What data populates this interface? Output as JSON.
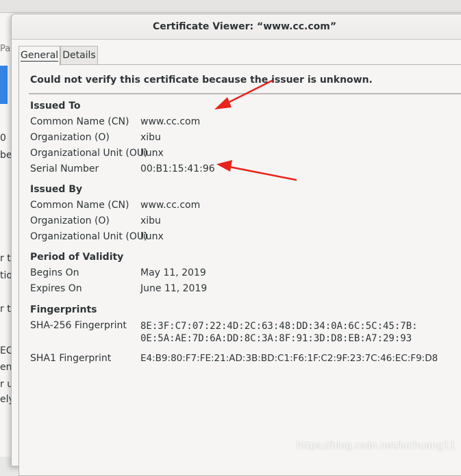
{
  "background_window": {
    "tab_fragment": "Pa",
    "fragments": [
      "0",
      "bes",
      "r to",
      "tio",
      "r t",
      "ECI",
      "en",
      "r ur",
      "ely"
    ]
  },
  "dialog": {
    "title": "Certificate Viewer: “www.cc.com”",
    "tabs": [
      {
        "label": "General",
        "active": true
      },
      {
        "label": "Details",
        "active": false
      }
    ],
    "warning": "Could not verify this certificate because the issuer is unknown.",
    "issued_to": {
      "title": "Issued To",
      "rows": [
        {
          "label": "Common Name (CN)",
          "value": "www.cc.com"
        },
        {
          "label": "Organization (O)",
          "value": "xibu"
        },
        {
          "label": "Organizational Unit (OU)",
          "value": "liunx"
        },
        {
          "label": "Serial Number",
          "value": "00:B1:15:41:96"
        }
      ]
    },
    "issued_by": {
      "title": "Issued By",
      "rows": [
        {
          "label": "Common Name (CN)",
          "value": "www.cc.com"
        },
        {
          "label": "Organization (O)",
          "value": "xibu"
        },
        {
          "label": "Organizational Unit (OU)",
          "value": "liunx"
        }
      ]
    },
    "validity": {
      "title": "Period of Validity",
      "rows": [
        {
          "label": "Begins On",
          "value": "May 11, 2019"
        },
        {
          "label": "Expires On",
          "value": "June 11, 2019"
        }
      ]
    },
    "fingerprints": {
      "title": "Fingerprints",
      "sha256_label": "SHA-256 Fingerprint",
      "sha256_line1": "8E:3F:C7:07:22:4D:2C:63:48:DD:34:0A:6C:5C:45:7B:",
      "sha256_line2": "0E:5A:AE:7D:6A:DD:8C:3A:8F:91:3D:D8:EB:A7:29:93",
      "sha1_label": "SHA1 Fingerprint",
      "sha1_value": "E4:B9:80:F7:FE:21:AD:3B:BD:C1:F6:1F:C2:9F:23:7C:46:EC:F9:D8"
    }
  },
  "annotation_color": "#e8231b",
  "watermark": "https://blog.csdn.net/luchuang11"
}
